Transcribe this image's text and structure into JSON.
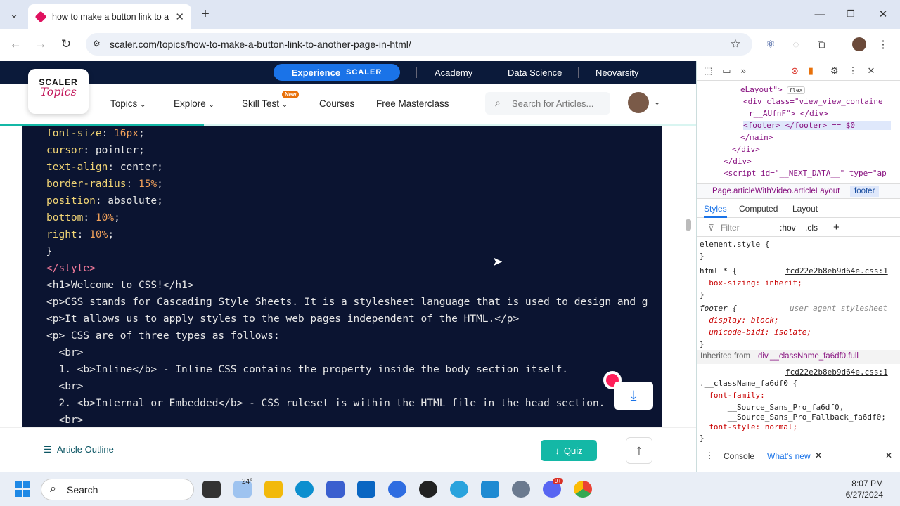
{
  "browser": {
    "tab_title": "how to make a button link to ar",
    "url": "scaler.com/topics/how-to-make-a-button-link-to-another-page-in-html/"
  },
  "site": {
    "experience_label": "Experience",
    "experience_brand": "SCALER",
    "banner_links": [
      "Academy",
      "Data Science",
      "Neovarsity"
    ],
    "logo_top": "SCALER",
    "logo_bottom": "Topics",
    "nav": [
      "Topics",
      "Explore",
      "Skill Test",
      "Courses",
      "Free Masterclass"
    ],
    "new_badge": "New",
    "search_placeholder": "Search for Articles...",
    "article_outline": "Article Outline",
    "quiz": "Quiz"
  },
  "code_lines": [
    "    font-size: 16px;",
    "    cursor: pointer;",
    "    text-align: center;",
    "    border-radius: 15%;",
    "    position: absolute;",
    "    bottom: 10%;",
    "    right: 10%;",
    "  }",
    "</style>",
    "<h1>Welcome to CSS!</h1>",
    "<p>CSS stands for Cascading Style Sheets. It is a stylesheet language that is used to design and g",
    "<p>It allows us to apply styles to the web pages independent of the HTML.</p>",
    "<p> CSS are of three types as follows:",
    "  <br>",
    "  1. <b>Inline</b> - Inline CSS contains the property inside the body section itself.",
    "  <br>",
    "  2. <b>Internal or Embedded</b> - CSS ruleset is within the HTML file in the head section.",
    "  <br>"
  ],
  "devtools": {
    "elements": [
      "eLayout\">",
      "<div class=\"view_view_containe",
      "r__AUfnF\"> </div>",
      "<footer> </footer> == $0",
      "</main>",
      "</div>",
      "</div>",
      "<script id=\"__NEXT_DATA__\" type=\"ap"
    ],
    "flex_badge": "flex",
    "breadcrumb_left": "Page.articleWithVideo.articleLayout",
    "breadcrumb_right": "footer",
    "tabs": [
      "Styles",
      "Computed",
      "Layout"
    ],
    "filter_placeholder": "Filter",
    "hov": ":hov",
    "cls": ".cls",
    "rules": [
      "element.style {",
      "}",
      "html * {",
      "  box-sizing: inherit;",
      "}",
      "footer {",
      "  display: block;",
      "  unicode-bidi: isolate;",
      "}"
    ],
    "source1": "fcd22e2b8eb9d64e.css:1",
    "user_agent": "user agent stylesheet",
    "inherited_label": "Inherited from",
    "inherited_from": "div.__className_fa6df0.full",
    "source2": "fcd22e2b8eb9d64e.css:1",
    "rules2": [
      ".__className_fa6df0 {",
      "  font-family:",
      "      __Source_Sans_Pro_fa6df0,",
      "      __Source_Sans_Pro_Fallback_fa6df0;",
      "  font-style: normal;",
      "}"
    ],
    "drawer_tabs": [
      "Console",
      "What's new"
    ]
  },
  "taskbar": {
    "search": "Search",
    "weather": "24°",
    "badge_count": "9+",
    "time": "8:07 PM",
    "date": "6/27/2024"
  }
}
